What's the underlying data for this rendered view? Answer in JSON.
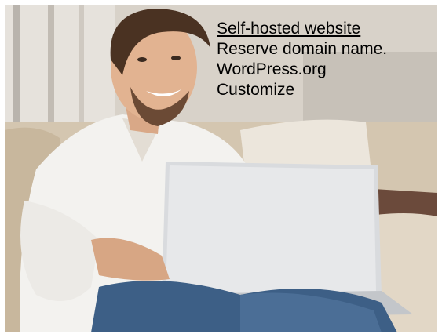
{
  "caption": {
    "heading": "Self-hosted website",
    "items": [
      "Reserve domain name.",
      "WordPress.org",
      "Customize"
    ]
  },
  "photo": {
    "subject": "man-with-laptop-on-sofa"
  },
  "colors": {
    "text": "#000000",
    "shirt": "#f4f4f2",
    "jeans": "#3d5f86",
    "laptop": "#d9dbde"
  }
}
